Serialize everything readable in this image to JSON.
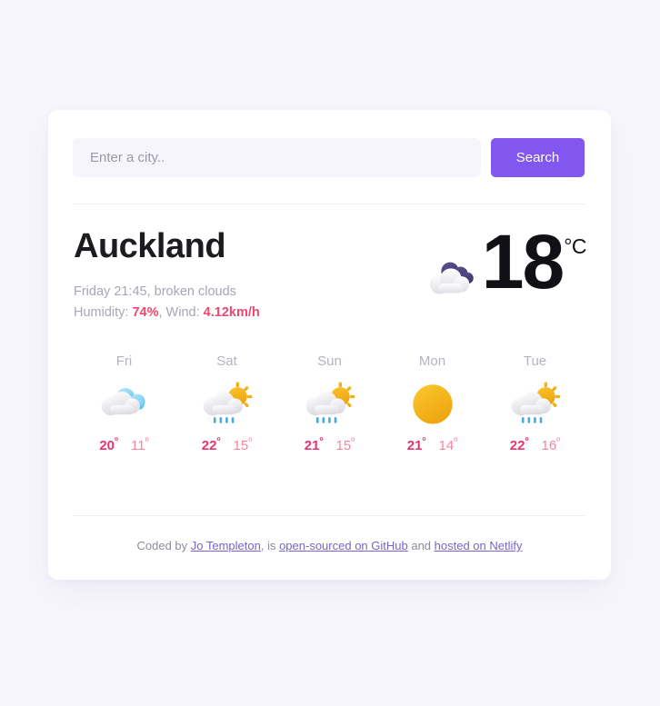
{
  "search": {
    "placeholder": "Enter a city..",
    "value": "",
    "button_label": "Search"
  },
  "current": {
    "city": "Auckland",
    "conditions_line": "Friday 21:45, broken clouds",
    "humidity_label": "Humidity: ",
    "humidity_value": "74%",
    "separator": ", Wind: ",
    "wind_value": "4.12km/h",
    "temperature": "18",
    "unit": "°C",
    "icon": "broken-clouds-icon"
  },
  "forecast": [
    {
      "day": "Fri",
      "icon": "cloudy-icon",
      "max": "20",
      "min": "11",
      "deg": "º"
    },
    {
      "day": "Sat",
      "icon": "sun-cloud-rain-icon",
      "max": "22",
      "min": "15",
      "deg": "º"
    },
    {
      "day": "Sun",
      "icon": "sun-cloud-rain-icon",
      "max": "21",
      "min": "15",
      "deg": "º"
    },
    {
      "day": "Mon",
      "icon": "sun-icon",
      "max": "21",
      "min": "14",
      "deg": "º"
    },
    {
      "day": "Tue",
      "icon": "sun-cloud-rain-icon",
      "max": "22",
      "min": "16",
      "deg": "º"
    }
  ],
  "footer": {
    "prefix": "Coded by ",
    "author_link": "Jo Templeton",
    "middle": ", is ",
    "source_link": "open-sourced on GitHub",
    "conjunction": " and ",
    "host_link": "hosted on Netlify"
  },
  "colors": {
    "page_background": "#f7f6fc",
    "card_background": "#ffffff",
    "accent_purple": "#8257f0",
    "temp_max_pink": "#e8336d",
    "temp_min_pink": "#f8849f",
    "stat_pink": "#ef476f",
    "muted_text": "#a7a7b4",
    "link_purple": "#7a63c9"
  }
}
